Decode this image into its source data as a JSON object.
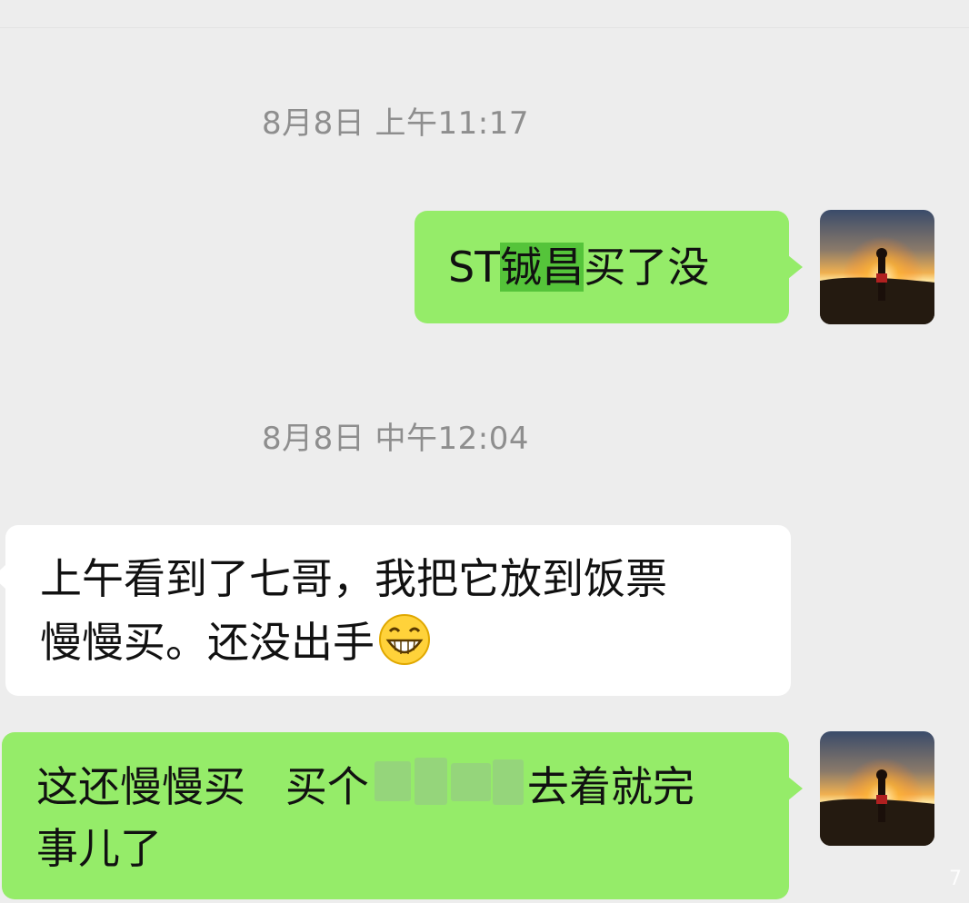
{
  "chat": {
    "timestamps": [
      "8月8日 上午11:17",
      "8月8日 中午12:04"
    ],
    "messages": [
      {
        "side": "out",
        "prefix": "ST",
        "highlight": "铖昌",
        "suffix": "买了没"
      },
      {
        "side": "in",
        "line1": "上午看到了七哥，我把它放到饭票",
        "line2": "慢慢买。还没出手",
        "emoji": "grinning-face-icon"
      },
      {
        "side": "out",
        "part1": "这还慢慢买   买个",
        "part2": "去着就完",
        "line2": "事儿了"
      }
    ]
  },
  "watermark": "7",
  "colors": {
    "background": "#ededed",
    "outgoing_bubble": "#95ec69",
    "incoming_bubble": "#ffffff",
    "highlight": "#55c43a",
    "timestamp_text": "#8e8e8e"
  },
  "icons": {
    "avatar": "sunset-avatar-image",
    "emoji": "grinning-face-icon"
  }
}
